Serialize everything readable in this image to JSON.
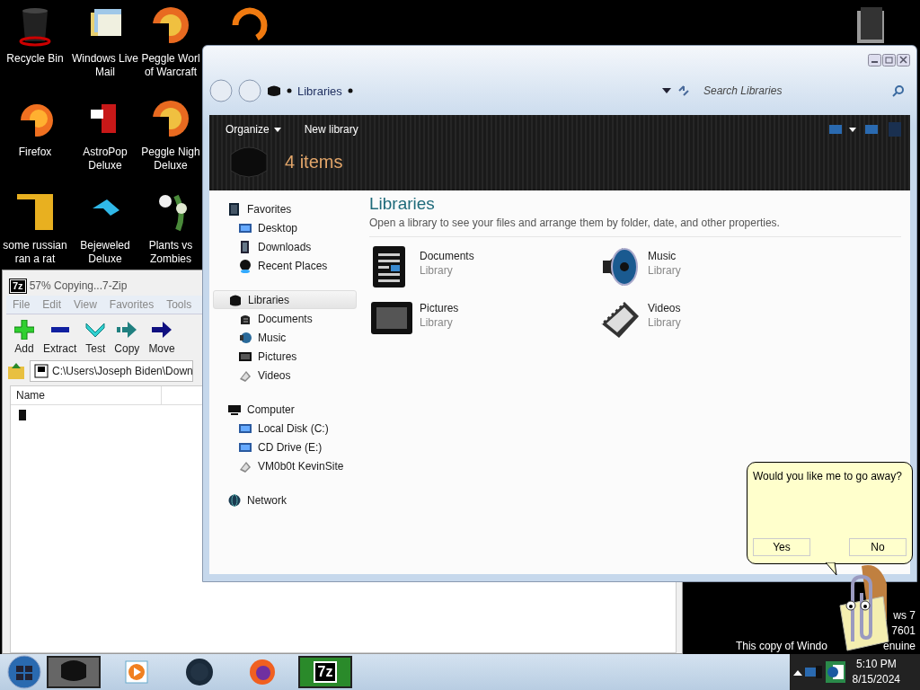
{
  "desktop_icons": [
    {
      "lines": [
        "Recycle Bin"
      ],
      "kind": "bin"
    },
    {
      "lines": [
        "Windows Live",
        "Mail"
      ],
      "kind": "mail"
    },
    {
      "lines": [
        "Peggle Worl",
        "of Warcraft"
      ],
      "kind": "peggle"
    },
    {
      "lines": [
        "Firefox"
      ],
      "kind": "firefox"
    },
    {
      "lines": [
        "AstroPop",
        "Deluxe"
      ],
      "kind": "astro"
    },
    {
      "lines": [
        "Peggle Nigh",
        "Deluxe"
      ],
      "kind": "peggle"
    },
    {
      "lines": [
        "some russian",
        "ran a rat"
      ],
      "kind": "rat"
    },
    {
      "lines": [
        "Bejeweled",
        "Deluxe"
      ],
      "kind": "gem"
    },
    {
      "lines": [
        "Plants vs",
        "Zombies"
      ],
      "kind": "plant"
    }
  ],
  "zip_window": {
    "icon_text": "7z",
    "title": "57% Copying...7-Zip",
    "menu": [
      "File",
      "Edit",
      "View",
      "Favorites",
      "Tools"
    ],
    "toolbar": [
      {
        "label": "Add",
        "kind": "add"
      },
      {
        "label": "Extract",
        "kind": "extract"
      },
      {
        "label": "Test",
        "kind": "test"
      },
      {
        "label": "Copy",
        "kind": "copy"
      },
      {
        "label": "Move",
        "kind": "move"
      }
    ],
    "path": "C:\\Users\\Joseph Biden\\Down",
    "columns": [
      "Name"
    ]
  },
  "explorer": {
    "breadcrumb": "Libraries",
    "search": {
      "placeholder": "Search Libraries"
    },
    "commands": [
      {
        "label": "Organize",
        "dropdown": true
      },
      {
        "label": "New library",
        "dropdown": false
      }
    ],
    "item_count": "4 items",
    "nav": [
      {
        "label": "Favorites",
        "selected": false,
        "children": [
          {
            "label": "Desktop",
            "selected": false
          },
          {
            "label": "Downloads",
            "selected": false
          },
          {
            "label": "Recent Places",
            "selected": false
          }
        ]
      },
      {
        "label": "Libraries",
        "selected": true,
        "children": [
          {
            "label": "Documents",
            "selected": false
          },
          {
            "label": "Music",
            "selected": false
          },
          {
            "label": "Pictures",
            "selected": false
          },
          {
            "label": "Videos",
            "selected": false
          }
        ]
      },
      {
        "label": "Computer",
        "selected": false,
        "children": [
          {
            "label": "Local Disk (C:)",
            "selected": false
          },
          {
            "label": "CD Drive (E:)",
            "selected": false
          },
          {
            "label": "VM0b0t KevinSite",
            "selected": false
          }
        ]
      },
      {
        "label": "Network",
        "selected": false
      }
    ],
    "heading": "Libraries",
    "description": "Open a library to see your files and arrange them by folder, date, and other properties.",
    "libraries": [
      {
        "name": "Documents",
        "type": "Library",
        "kind": "documents"
      },
      {
        "name": "Music",
        "type": "Library",
        "kind": "music"
      },
      {
        "name": "Pictures",
        "type": "Library",
        "kind": "pictures"
      },
      {
        "name": "Videos",
        "type": "Library",
        "kind": "videos"
      }
    ]
  },
  "assistant": {
    "message": "Would you like me to go away?",
    "buttons": [
      "Yes",
      "No"
    ]
  },
  "activation_notice": [
    "ws 7",
    "7601",
    "This copy of Windo",
    "enuine"
  ],
  "taskbar": {
    "apps": [
      {
        "kind": "library",
        "selected": true
      },
      {
        "kind": "media",
        "selected": false
      },
      {
        "kind": "globe",
        "selected": false
      },
      {
        "kind": "firefox",
        "selected": false
      },
      {
        "kind": "zip",
        "selected": true,
        "label": "7z"
      }
    ],
    "time": "5:10 PM",
    "date": "8/15/2024"
  }
}
